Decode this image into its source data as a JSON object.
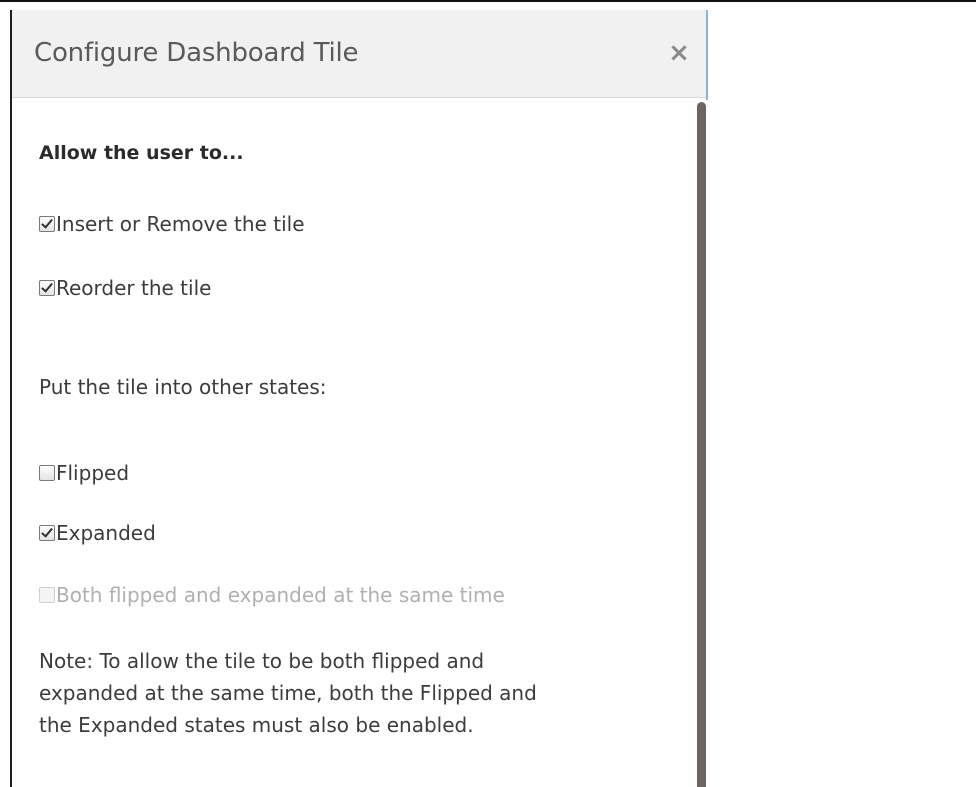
{
  "dialog": {
    "title": "Configure Dashboard Tile",
    "close_glyph": "×",
    "close_icon": "close-icon"
  },
  "section_user": {
    "heading": "Allow the user to...",
    "options": [
      {
        "label": "Insert or Remove the tile",
        "checked": true,
        "disabled": false
      },
      {
        "label": "Reorder the tile",
        "checked": true,
        "disabled": false
      }
    ]
  },
  "section_states": {
    "heading": "Put the tile into other states:",
    "options": [
      {
        "label": "Flipped",
        "checked": false,
        "disabled": false
      },
      {
        "label": "Expanded",
        "checked": true,
        "disabled": false
      },
      {
        "label": "Both flipped and expanded at the same time",
        "checked": false,
        "disabled": true
      }
    ]
  },
  "note": {
    "lines": [
      "Note: To allow the tile to be both flipped and",
      "expanded at the same time, both the Flipped and",
      "the Expanded states must also be enabled."
    ]
  },
  "colors": {
    "header_bg": "#f1f1f1",
    "scroll_thumb": "#6e6462",
    "text": "#3c3c3c",
    "disabled_text": "#b0b0b0"
  }
}
